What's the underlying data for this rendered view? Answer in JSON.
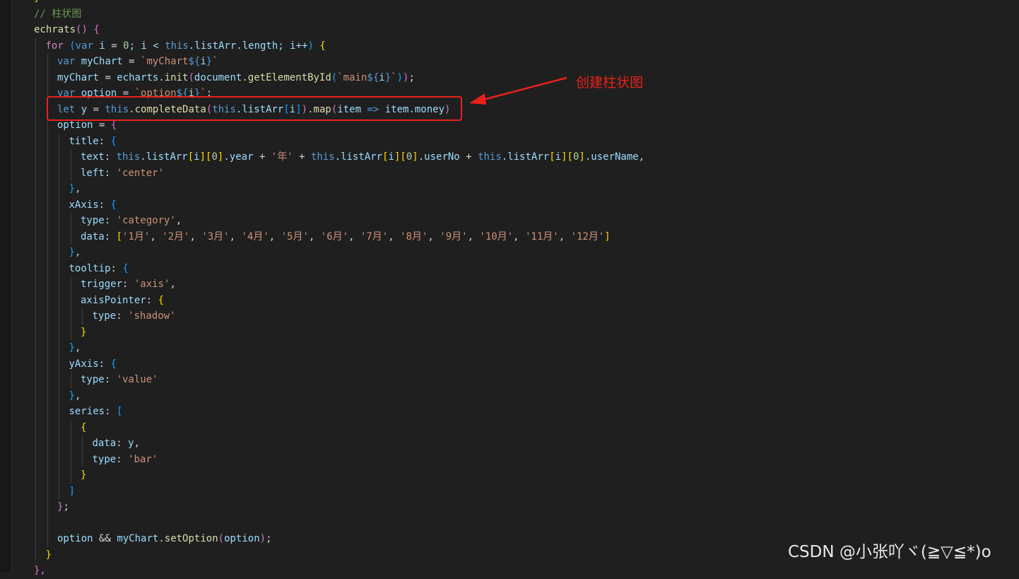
{
  "editor": {
    "theme": "dark",
    "lines": [
      {
        "indent": 1,
        "tokens": [
          {
            "t": "}",
            "c": "br1"
          }
        ]
      },
      {
        "indent": 1,
        "tokens": [
          {
            "t": "// 柱状图",
            "c": "cmt"
          }
        ]
      },
      {
        "indent": 1,
        "tokens": [
          {
            "t": "echrats",
            "c": "fn"
          },
          {
            "t": "() ",
            "c": "br2"
          },
          {
            "t": "{",
            "c": "br2"
          }
        ]
      },
      {
        "indent": 2,
        "tokens": [
          {
            "t": "for",
            "c": "kw"
          },
          {
            "t": " ",
            "c": "punc"
          },
          {
            "t": "(",
            "c": "br3"
          },
          {
            "t": "var",
            "c": "st"
          },
          {
            "t": " i ",
            "c": "var"
          },
          {
            "t": "= ",
            "c": "punc"
          },
          {
            "t": "0",
            "c": "num"
          },
          {
            "t": "; i < ",
            "c": "var"
          },
          {
            "t": "this",
            "c": "st"
          },
          {
            "t": ".listArr.length; i++",
            "c": "var"
          },
          {
            "t": ")",
            "c": "br3"
          },
          {
            "t": " ",
            "c": "punc"
          },
          {
            "t": "{",
            "c": "br1"
          }
        ]
      },
      {
        "indent": 3,
        "tokens": [
          {
            "t": "var",
            "c": "st"
          },
          {
            "t": " myChart ",
            "c": "var"
          },
          {
            "t": "= ",
            "c": "punc"
          },
          {
            "t": "`myChart",
            "c": "str"
          },
          {
            "t": "${",
            "c": "st"
          },
          {
            "t": "i",
            "c": "var"
          },
          {
            "t": "}",
            "c": "st"
          },
          {
            "t": "`",
            "c": "str"
          }
        ]
      },
      {
        "indent": 3,
        "tokens": [
          {
            "t": "myChart ",
            "c": "var"
          },
          {
            "t": "= ",
            "c": "punc"
          },
          {
            "t": "echarts",
            "c": "var"
          },
          {
            "t": ".",
            "c": "punc"
          },
          {
            "t": "init",
            "c": "fn"
          },
          {
            "t": "(",
            "c": "br2"
          },
          {
            "t": "document",
            "c": "var"
          },
          {
            "t": ".",
            "c": "punc"
          },
          {
            "t": "getElementById",
            "c": "fn"
          },
          {
            "t": "(",
            "c": "br3"
          },
          {
            "t": "`main",
            "c": "str"
          },
          {
            "t": "${",
            "c": "st"
          },
          {
            "t": "i",
            "c": "var"
          },
          {
            "t": "}",
            "c": "st"
          },
          {
            "t": "`",
            "c": "str"
          },
          {
            "t": ")",
            "c": "br3"
          },
          {
            "t": ")",
            "c": "br2"
          },
          {
            "t": ";",
            "c": "punc"
          }
        ]
      },
      {
        "indent": 3,
        "tokens": [
          {
            "t": "var",
            "c": "st"
          },
          {
            "t": " option ",
            "c": "var"
          },
          {
            "t": "= ",
            "c": "punc"
          },
          {
            "t": "`option",
            "c": "str"
          },
          {
            "t": "${",
            "c": "st"
          },
          {
            "t": "i",
            "c": "var"
          },
          {
            "t": "}",
            "c": "st"
          },
          {
            "t": "`",
            "c": "str"
          },
          {
            "t": ";",
            "c": "punc"
          }
        ]
      },
      {
        "indent": 3,
        "tokens": [
          {
            "t": "let",
            "c": "st"
          },
          {
            "t": " y ",
            "c": "var"
          },
          {
            "t": "= ",
            "c": "punc"
          },
          {
            "t": "this",
            "c": "st"
          },
          {
            "t": ".",
            "c": "punc"
          },
          {
            "t": "completeData",
            "c": "fn"
          },
          {
            "t": "(",
            "c": "br2"
          },
          {
            "t": "this",
            "c": "st"
          },
          {
            "t": ".listArr",
            "c": "var"
          },
          {
            "t": "[",
            "c": "br3"
          },
          {
            "t": "i",
            "c": "var"
          },
          {
            "t": "]",
            "c": "br3"
          },
          {
            "t": ")",
            "c": "br2"
          },
          {
            "t": ".",
            "c": "punc"
          },
          {
            "t": "map",
            "c": "fn"
          },
          {
            "t": "(",
            "c": "br2"
          },
          {
            "t": "item ",
            "c": "var"
          },
          {
            "t": "=> ",
            "c": "st"
          },
          {
            "t": "item.money",
            "c": "var"
          },
          {
            "t": ")",
            "c": "br2"
          }
        ]
      },
      {
        "indent": 3,
        "tokens": [
          {
            "t": "option ",
            "c": "var"
          },
          {
            "t": "= ",
            "c": "punc"
          },
          {
            "t": "{",
            "c": "br2"
          }
        ]
      },
      {
        "indent": 4,
        "tokens": [
          {
            "t": "title",
            "c": "var"
          },
          {
            "t": ": ",
            "c": "punc"
          },
          {
            "t": "{",
            "c": "br3"
          }
        ]
      },
      {
        "indent": 5,
        "tokens": [
          {
            "t": "text",
            "c": "var"
          },
          {
            "t": ": ",
            "c": "punc"
          },
          {
            "t": "this",
            "c": "st"
          },
          {
            "t": ".listArr",
            "c": "var"
          },
          {
            "t": "[",
            "c": "br1"
          },
          {
            "t": "i",
            "c": "var"
          },
          {
            "t": "]",
            "c": "br1"
          },
          {
            "t": "[",
            "c": "br1"
          },
          {
            "t": "0",
            "c": "num"
          },
          {
            "t": "]",
            "c": "br1"
          },
          {
            "t": ".year ",
            "c": "var"
          },
          {
            "t": "+ ",
            "c": "punc"
          },
          {
            "t": "'年' ",
            "c": "str"
          },
          {
            "t": "+ ",
            "c": "punc"
          },
          {
            "t": "this",
            "c": "st"
          },
          {
            "t": ".listArr",
            "c": "var"
          },
          {
            "t": "[",
            "c": "br1"
          },
          {
            "t": "i",
            "c": "var"
          },
          {
            "t": "]",
            "c": "br1"
          },
          {
            "t": "[",
            "c": "br1"
          },
          {
            "t": "0",
            "c": "num"
          },
          {
            "t": "]",
            "c": "br1"
          },
          {
            "t": ".userNo ",
            "c": "var"
          },
          {
            "t": "+ ",
            "c": "punc"
          },
          {
            "t": "this",
            "c": "st"
          },
          {
            "t": ".listArr",
            "c": "var"
          },
          {
            "t": "[",
            "c": "br1"
          },
          {
            "t": "i",
            "c": "var"
          },
          {
            "t": "]",
            "c": "br1"
          },
          {
            "t": "[",
            "c": "br1"
          },
          {
            "t": "0",
            "c": "num"
          },
          {
            "t": "]",
            "c": "br1"
          },
          {
            "t": ".userName",
            "c": "var"
          },
          {
            "t": ",",
            "c": "punc"
          }
        ]
      },
      {
        "indent": 5,
        "tokens": [
          {
            "t": "left",
            "c": "var"
          },
          {
            "t": ": ",
            "c": "punc"
          },
          {
            "t": "'center'",
            "c": "str"
          }
        ]
      },
      {
        "indent": 4,
        "tokens": [
          {
            "t": "}",
            "c": "br3"
          },
          {
            "t": ",",
            "c": "punc"
          }
        ]
      },
      {
        "indent": 4,
        "tokens": [
          {
            "t": "xAxis",
            "c": "var"
          },
          {
            "t": ": ",
            "c": "punc"
          },
          {
            "t": "{",
            "c": "br3"
          }
        ]
      },
      {
        "indent": 5,
        "tokens": [
          {
            "t": "type",
            "c": "var"
          },
          {
            "t": ": ",
            "c": "punc"
          },
          {
            "t": "'category'",
            "c": "str"
          },
          {
            "t": ",",
            "c": "punc"
          }
        ]
      },
      {
        "indent": 5,
        "tokens": [
          {
            "t": "data",
            "c": "var"
          },
          {
            "t": ": ",
            "c": "punc"
          },
          {
            "t": "[",
            "c": "br1"
          },
          {
            "t": "'1月'",
            "c": "str"
          },
          {
            "t": ", ",
            "c": "punc"
          },
          {
            "t": "'2月'",
            "c": "str"
          },
          {
            "t": ", ",
            "c": "punc"
          },
          {
            "t": "'3月'",
            "c": "str"
          },
          {
            "t": ", ",
            "c": "punc"
          },
          {
            "t": "'4月'",
            "c": "str"
          },
          {
            "t": ", ",
            "c": "punc"
          },
          {
            "t": "'5月'",
            "c": "str"
          },
          {
            "t": ", ",
            "c": "punc"
          },
          {
            "t": "'6月'",
            "c": "str"
          },
          {
            "t": ", ",
            "c": "punc"
          },
          {
            "t": "'7月'",
            "c": "str"
          },
          {
            "t": ", ",
            "c": "punc"
          },
          {
            "t": "'8月'",
            "c": "str"
          },
          {
            "t": ", ",
            "c": "punc"
          },
          {
            "t": "'9月'",
            "c": "str"
          },
          {
            "t": ", ",
            "c": "punc"
          },
          {
            "t": "'10月'",
            "c": "str"
          },
          {
            "t": ", ",
            "c": "punc"
          },
          {
            "t": "'11月'",
            "c": "str"
          },
          {
            "t": ", ",
            "c": "punc"
          },
          {
            "t": "'12月'",
            "c": "str"
          },
          {
            "t": "]",
            "c": "br1"
          }
        ]
      },
      {
        "indent": 4,
        "tokens": [
          {
            "t": "}",
            "c": "br3"
          },
          {
            "t": ",",
            "c": "punc"
          }
        ]
      },
      {
        "indent": 4,
        "tokens": [
          {
            "t": "tooltip",
            "c": "var"
          },
          {
            "t": ": ",
            "c": "punc"
          },
          {
            "t": "{",
            "c": "br3"
          }
        ]
      },
      {
        "indent": 5,
        "tokens": [
          {
            "t": "trigger",
            "c": "var"
          },
          {
            "t": ": ",
            "c": "punc"
          },
          {
            "t": "'axis'",
            "c": "str"
          },
          {
            "t": ",",
            "c": "punc"
          }
        ]
      },
      {
        "indent": 5,
        "tokens": [
          {
            "t": "axisPointer",
            "c": "var"
          },
          {
            "t": ": ",
            "c": "punc"
          },
          {
            "t": "{",
            "c": "br1"
          }
        ]
      },
      {
        "indent": 6,
        "tokens": [
          {
            "t": "type",
            "c": "var"
          },
          {
            "t": ": ",
            "c": "punc"
          },
          {
            "t": "'shadow'",
            "c": "str"
          }
        ]
      },
      {
        "indent": 5,
        "tokens": [
          {
            "t": "}",
            "c": "br1"
          }
        ]
      },
      {
        "indent": 4,
        "tokens": [
          {
            "t": "}",
            "c": "br3"
          },
          {
            "t": ",",
            "c": "punc"
          }
        ]
      },
      {
        "indent": 4,
        "tokens": [
          {
            "t": "yAxis",
            "c": "var"
          },
          {
            "t": ": ",
            "c": "punc"
          },
          {
            "t": "{",
            "c": "br3"
          }
        ]
      },
      {
        "indent": 5,
        "tokens": [
          {
            "t": "type",
            "c": "var"
          },
          {
            "t": ": ",
            "c": "punc"
          },
          {
            "t": "'value'",
            "c": "str"
          }
        ]
      },
      {
        "indent": 4,
        "tokens": [
          {
            "t": "}",
            "c": "br3"
          },
          {
            "t": ",",
            "c": "punc"
          }
        ]
      },
      {
        "indent": 4,
        "tokens": [
          {
            "t": "series",
            "c": "var"
          },
          {
            "t": ": ",
            "c": "punc"
          },
          {
            "t": "[",
            "c": "br3"
          }
        ]
      },
      {
        "indent": 5,
        "tokens": [
          {
            "t": "{",
            "c": "br1"
          }
        ]
      },
      {
        "indent": 6,
        "tokens": [
          {
            "t": "data",
            "c": "var"
          },
          {
            "t": ": ",
            "c": "punc"
          },
          {
            "t": "y",
            "c": "var"
          },
          {
            "t": ",",
            "c": "punc"
          }
        ]
      },
      {
        "indent": 6,
        "tokens": [
          {
            "t": "type",
            "c": "var"
          },
          {
            "t": ": ",
            "c": "punc"
          },
          {
            "t": "'bar'",
            "c": "str"
          }
        ]
      },
      {
        "indent": 5,
        "tokens": [
          {
            "t": "}",
            "c": "br1"
          }
        ]
      },
      {
        "indent": 4,
        "tokens": [
          {
            "t": "]",
            "c": "br3"
          }
        ]
      },
      {
        "indent": 3,
        "tokens": [
          {
            "t": "}",
            "c": "br2"
          },
          {
            "t": ";",
            "c": "punc"
          }
        ]
      },
      {
        "indent": 3,
        "tokens": []
      },
      {
        "indent": 3,
        "tokens": [
          {
            "t": "option ",
            "c": "var"
          },
          {
            "t": "&& ",
            "c": "punc"
          },
          {
            "t": "myChart",
            "c": "var"
          },
          {
            "t": ".",
            "c": "punc"
          },
          {
            "t": "setOption",
            "c": "fn"
          },
          {
            "t": "(",
            "c": "br2"
          },
          {
            "t": "option",
            "c": "var"
          },
          {
            "t": ")",
            "c": "br2"
          },
          {
            "t": ";",
            "c": "punc"
          }
        ]
      },
      {
        "indent": 2,
        "tokens": [
          {
            "t": "}",
            "c": "br1"
          }
        ]
      },
      {
        "indent": 1,
        "tokens": [
          {
            "t": "},",
            "c": "br2"
          }
        ]
      }
    ]
  },
  "annotation": {
    "text": "创建柱状图",
    "color": "#e8221b"
  },
  "watermark": {
    "text": "CSDN @小张吖ヾ(≧▽≦*)o"
  }
}
